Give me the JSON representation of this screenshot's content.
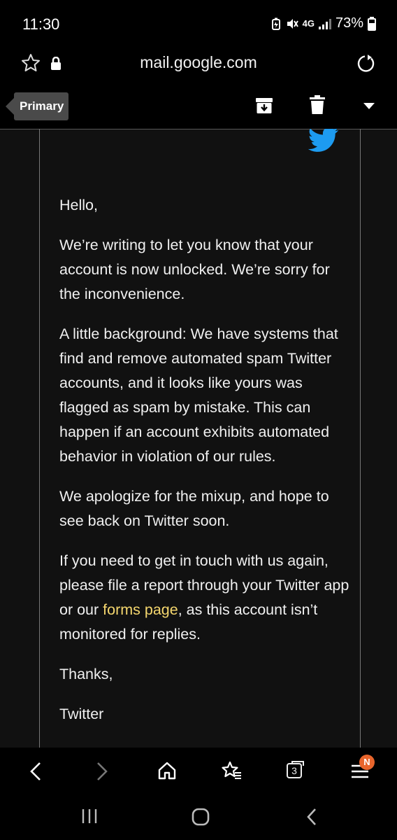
{
  "status_bar": {
    "time": "11:30",
    "network": "4G",
    "battery": "73%"
  },
  "browser": {
    "url": "mail.google.com"
  },
  "toolbar": {
    "label_tag": "Primary"
  },
  "email": {
    "paragraphs": [
      "Hello,",
      "We’re writing to let you know that your account is now unlocked. We’re sorry for the inconvenience.",
      "A little background: We have systems that find and remove automated spam Twitter accounts, and it looks like yours was flagged as spam by mistake. This can happen if an account exhibits automated behavior in violation of our rules.",
      "We apologize for the mixup, and hope to see back on Twitter soon."
    ],
    "contact_before": "If you need to get in touch with us again, please file a report through your Twitter app or our ",
    "contact_link": "forms page",
    "contact_after": ", as this account isn’t monitored for replies.",
    "signoff": "Thanks,",
    "signature": "Twitter"
  },
  "bottom_nav": {
    "tab_count": "3",
    "notification_badge": "N"
  },
  "colors": {
    "link": "#f5d76e",
    "twitter_blue": "#1d9bf0",
    "badge": "#e8652c"
  }
}
